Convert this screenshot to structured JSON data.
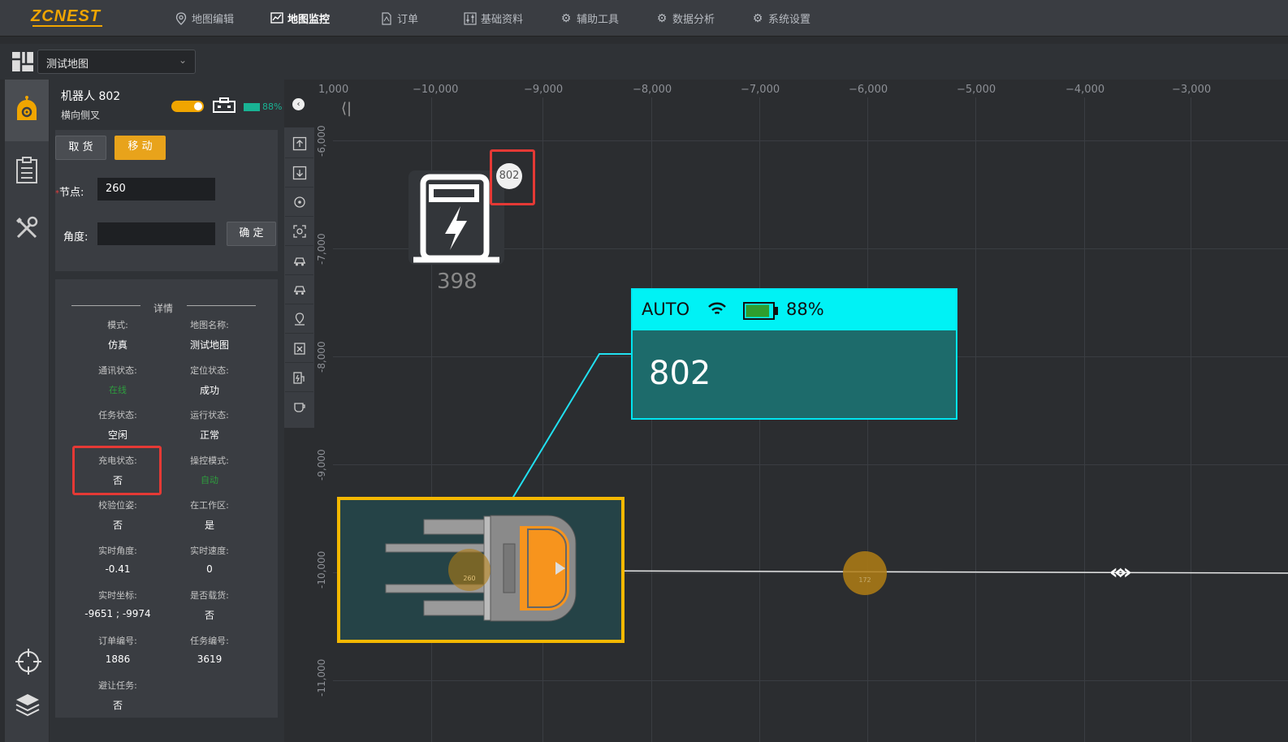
{
  "app": {
    "logo": "ZCNEST"
  },
  "nav": [
    {
      "label": "地图编辑",
      "icon": "map-pin-icon",
      "active": false
    },
    {
      "label": "地图监控",
      "icon": "chart-icon",
      "active": true
    },
    {
      "label": "订单",
      "icon": "document-icon",
      "active": false
    },
    {
      "label": "基础资料",
      "icon": "sliders-icon",
      "active": false
    },
    {
      "label": "辅助工具",
      "icon": "gear-icon",
      "active": false
    },
    {
      "label": "数据分析",
      "icon": "gear-icon",
      "active": false
    },
    {
      "label": "系统设置",
      "icon": "gear-icon",
      "active": false
    }
  ],
  "map_select": {
    "value": "测试地图"
  },
  "robot": {
    "title": "机器人  802",
    "type": "横向侧叉",
    "battery": "88%",
    "battery_level": 0.88
  },
  "actions": {
    "pickup_label": "取 货",
    "move_label": "移 动",
    "node_label": "节点:",
    "node_value": "260",
    "angle_label": "角度:",
    "angle_value": "",
    "confirm_label": "确 定"
  },
  "details": {
    "title": "详情",
    "items": [
      {
        "key": "模式:",
        "value": "仿真"
      },
      {
        "key": "地图名称:",
        "value": "测试地图"
      },
      {
        "key": "通讯状态:",
        "value": "在线",
        "green": true
      },
      {
        "key": "定位状态:",
        "value": "成功"
      },
      {
        "key": "任务状态:",
        "value": "空闲"
      },
      {
        "key": "运行状态:",
        "value": "正常"
      },
      {
        "key": "充电状态:",
        "value": "否"
      },
      {
        "key": "操控模式:",
        "value": "自动",
        "green": true
      },
      {
        "key": "校验位姿:",
        "value": "否"
      },
      {
        "key": "在工作区:",
        "value": "是"
      },
      {
        "key": "实时角度:",
        "value": "-0.41"
      },
      {
        "key": "实时速度:",
        "value": "0"
      },
      {
        "key": "实时坐标:",
        "value": "-9651  ;  -9974"
      },
      {
        "key": "是否载货:",
        "value": "否"
      },
      {
        "key": "订单编号:",
        "value": "1886"
      },
      {
        "key": "任务编号:",
        "value": "3619"
      },
      {
        "key": "避让任务:",
        "value": "否"
      }
    ]
  },
  "map": {
    "x_ticks": [
      "1,000",
      "−10,000",
      "−9,000",
      "−8,000",
      "−7,000",
      "−6,000",
      "−5,000",
      "−4,000",
      "−3,000"
    ],
    "y_ticks": [
      "-6,000",
      "-7,000",
      "-8,000",
      "-9,000",
      "-10,000",
      "-11,000"
    ],
    "charger_number": "398",
    "charger_badge": "802",
    "info": {
      "mode": "AUTO",
      "battery": "88%",
      "robot_id": "802"
    },
    "node_label": "260",
    "node2_label": "172"
  }
}
